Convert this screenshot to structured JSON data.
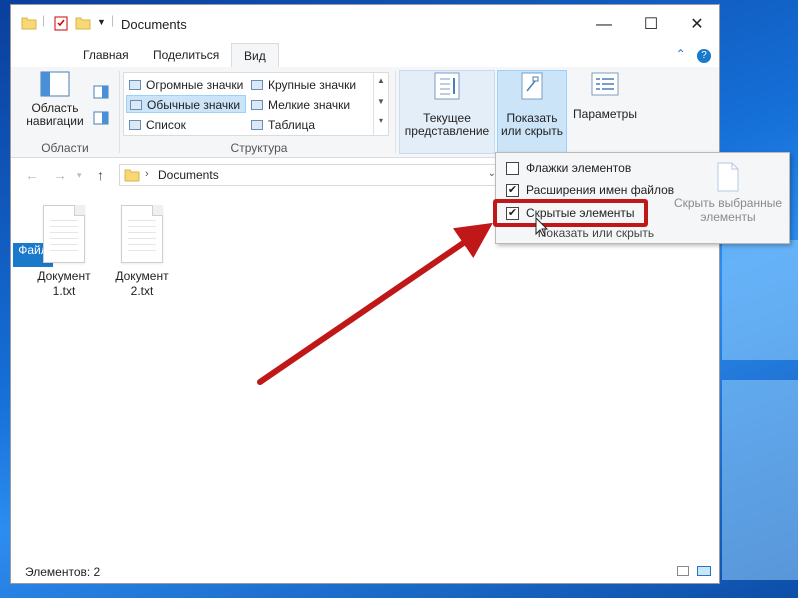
{
  "window": {
    "title": "Documents",
    "minimize_glyph": "—",
    "maximize_glyph": "☐",
    "close_glyph": "✕"
  },
  "tabs": [
    {
      "label": "Файл"
    },
    {
      "label": "Главная"
    },
    {
      "label": "Поделиться"
    },
    {
      "label": "Вид"
    }
  ],
  "ribbon": {
    "nav_pane_label": "Область навигации",
    "areas_group": "Области",
    "layout_items": [
      "Огромные значки",
      "Крупные значки",
      "Обычные значки",
      "Мелкие значки",
      "Список",
      "Таблица"
    ],
    "structure_group": "Структура",
    "current_view_label": "Текущее представление",
    "show_hide_label": "Показать или скрыть",
    "params_label": "Параметры"
  },
  "address": {
    "path": "Documents"
  },
  "files": [
    {
      "name": "Документ 1.txt"
    },
    {
      "name": "Документ 2.txt"
    }
  ],
  "status": {
    "text": "Элементов: 2"
  },
  "dropdown": {
    "items": [
      {
        "label": "Флажки элементов",
        "checked": false
      },
      {
        "label": "Расширения имен файлов",
        "checked": true
      },
      {
        "label": "Скрытые элементы",
        "checked": true
      }
    ],
    "hide_selected": "Скрыть выбранные элементы",
    "footer": "Показать или скрыть",
    "check_glyph": "✔"
  },
  "colors": {
    "accent": "#1979ca",
    "highlight": "#c01818"
  }
}
